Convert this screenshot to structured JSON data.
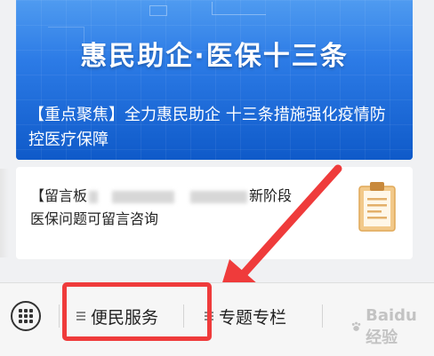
{
  "banner": {
    "title": "惠民助企·医保十三条",
    "caption": "【重点聚焦】全力惠民助企 十三条措施强化疫情防控医疗保障"
  },
  "message_card": {
    "line1_prefix": "【留言板",
    "line1_suffix": "新阶段",
    "line2": "医保问题可留言咨询",
    "icon": "clipboard-icon"
  },
  "bottom_nav": {
    "keyboard_icon": "keyboard-icon",
    "items": [
      {
        "label": "便民服务",
        "icon": "menu-icon"
      },
      {
        "label": "专题专栏",
        "icon": "menu-icon"
      }
    ]
  },
  "annotation": {
    "color": "#ef3b3b"
  },
  "watermark": {
    "text": "Baidu 经验"
  }
}
